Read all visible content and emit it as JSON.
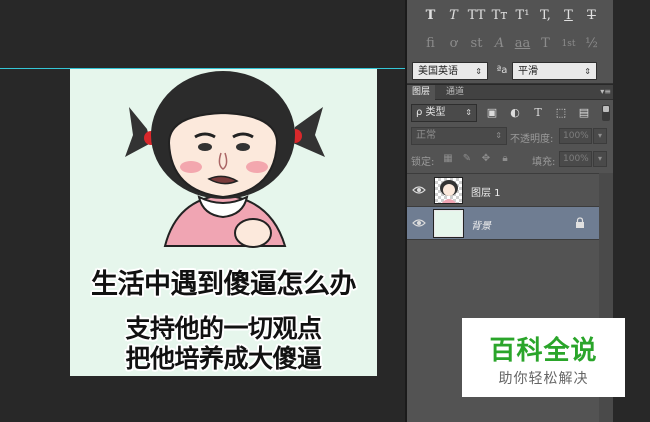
{
  "canvas": {
    "meme_captions": [
      "生活中遇到傻逼怎么办",
      "支持他的一切观点",
      "把他培养成大傻逼"
    ]
  },
  "character_panel": {
    "glyph_row_1": [
      "T",
      "T",
      "TT",
      "Tт",
      "T¹",
      "T,",
      "T",
      "T"
    ],
    "glyph_row_2": [
      "fi",
      "ơ",
      "st",
      "A",
      "aa",
      "T",
      "1st",
      "½"
    ],
    "language": "美国英语",
    "aa_label": "ªa",
    "antialias": "平滑"
  },
  "layers_panel": {
    "tabs": [
      "图层",
      "通道"
    ],
    "kind_filter": "ρ 类型",
    "blend_mode": "正常",
    "opacity_label": "不透明度:",
    "opacity_value": "100%",
    "lock_label": "锁定:",
    "fill_label": "填充:",
    "fill_value": "100%",
    "layers": [
      {
        "name": "图层 1",
        "selected": false
      },
      {
        "name": "背景",
        "selected": true
      }
    ]
  },
  "watermark": {
    "title": "百科全说",
    "subtitle": "助你轻松解决"
  },
  "colors": {
    "guide": "#35c6d6",
    "selected_layer": "#6f7d92",
    "watermark_green": "#2aa52a"
  }
}
